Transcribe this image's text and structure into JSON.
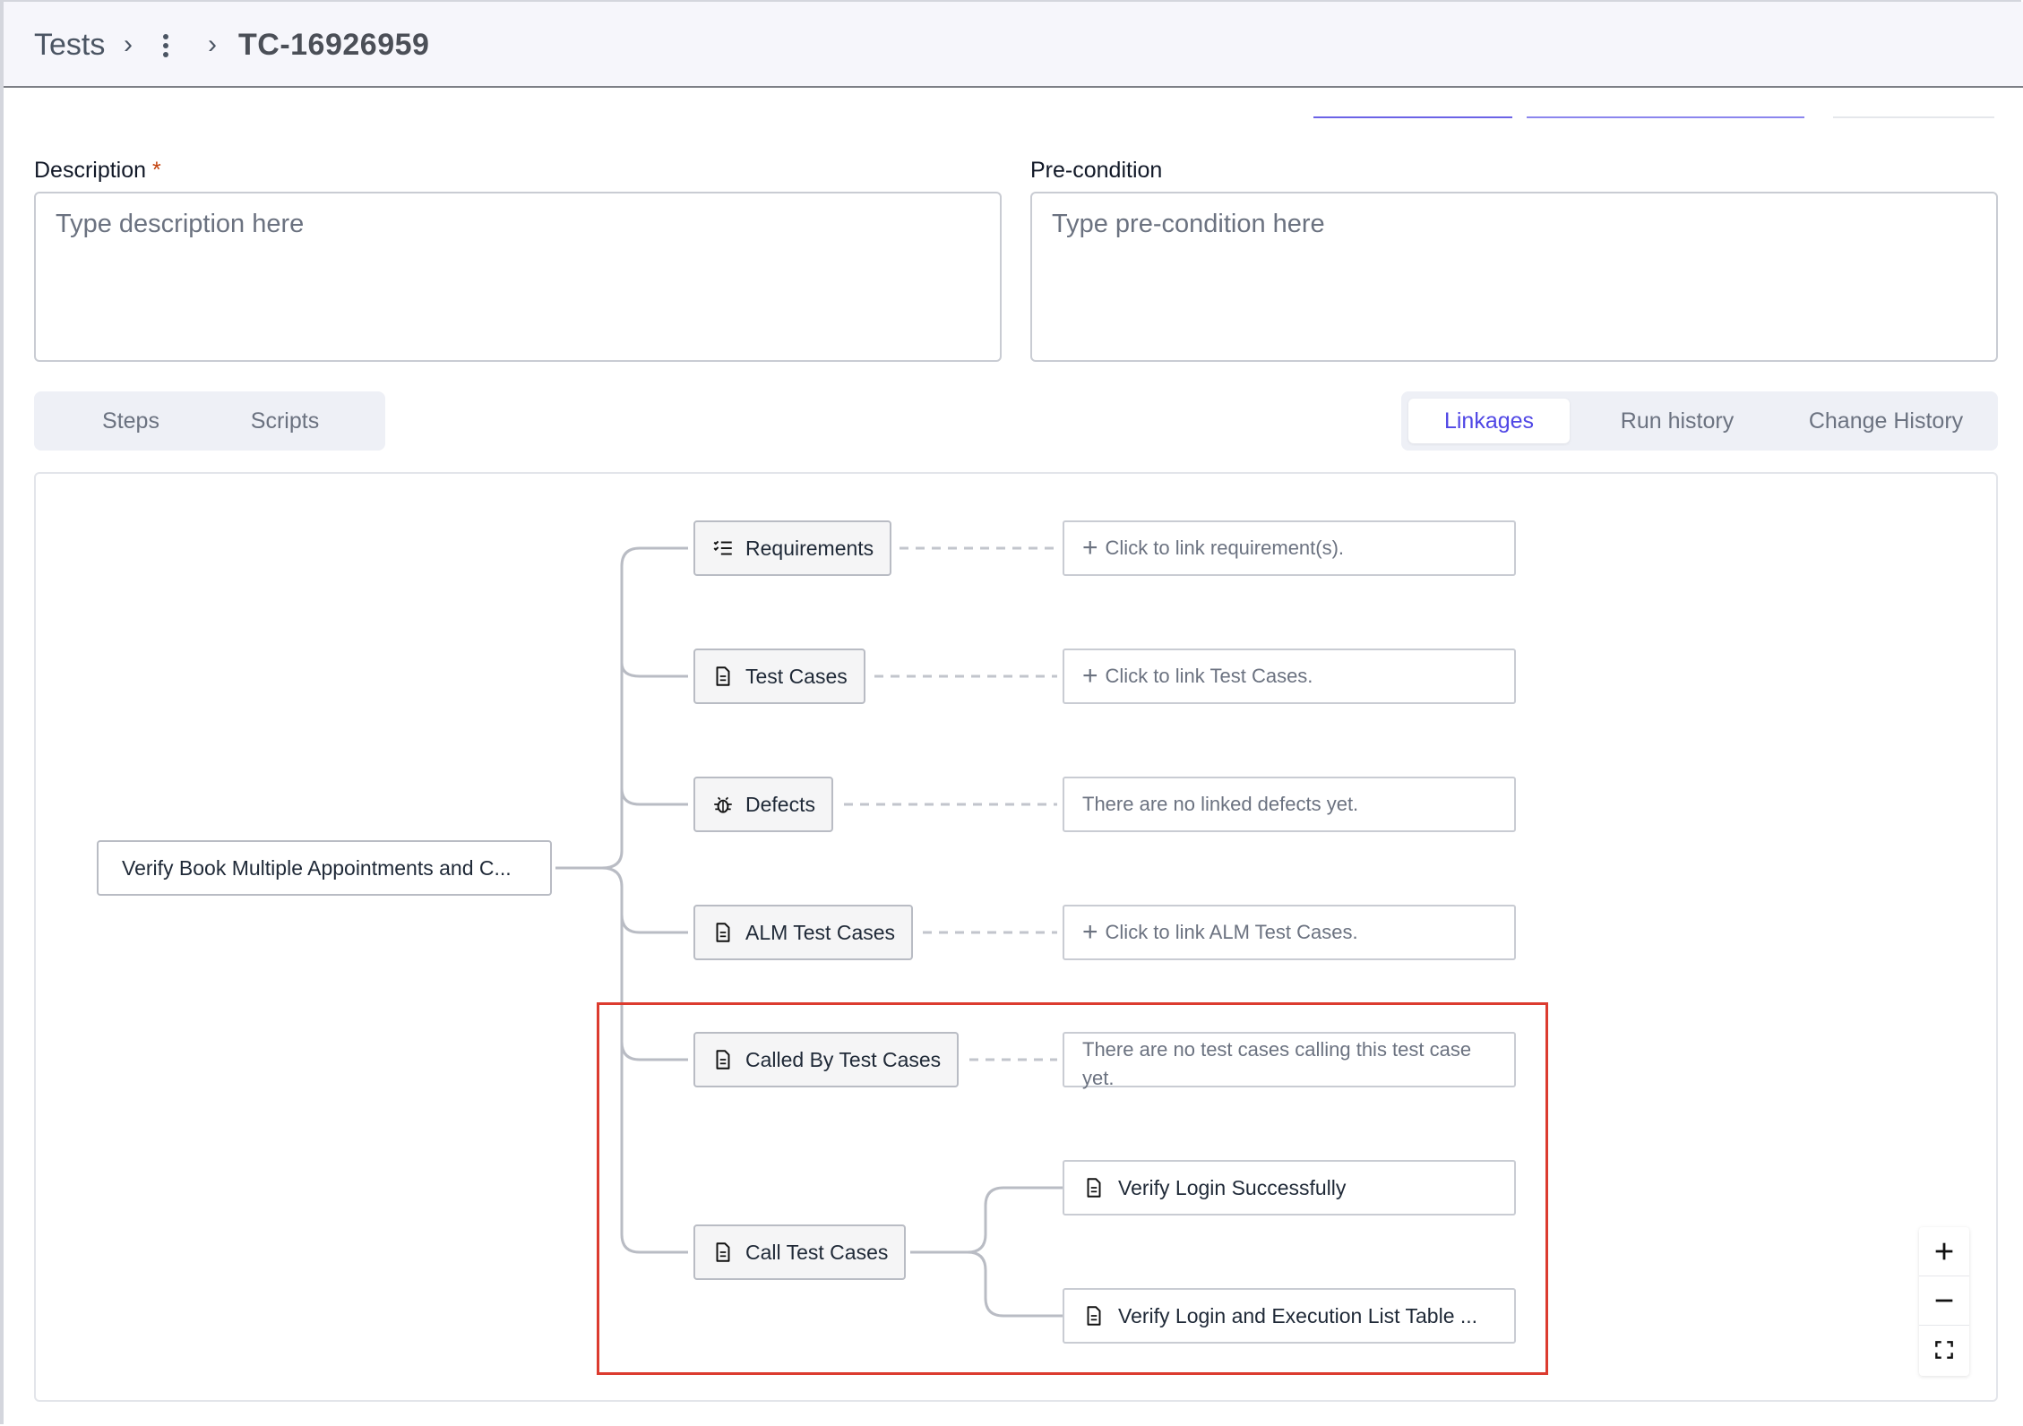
{
  "breadcrumb": {
    "root": "Tests",
    "current": "TC-16926959"
  },
  "form": {
    "description_label": "Description",
    "description_required": "*",
    "description_placeholder": "Type description here",
    "precondition_label": "Pre-condition",
    "precondition_placeholder": "Type pre-condition here"
  },
  "left_tabs": [
    {
      "label": "Steps",
      "active": false
    },
    {
      "label": "Scripts",
      "active": false
    }
  ],
  "right_tabs": [
    {
      "label": "Linkages",
      "active": true
    },
    {
      "label": "Run history",
      "active": false
    },
    {
      "label": "Change History",
      "active": false
    }
  ],
  "linkage_map": {
    "root": "Verify Book Multiple Appointments and C...",
    "branches": [
      {
        "label": "Requirements",
        "icon": "checklist-icon",
        "target": "Click to link requirement(s)."
      },
      {
        "label": "Test Cases",
        "icon": "document-icon",
        "target": "Click to link Test Cases."
      },
      {
        "label": "Defects",
        "icon": "bug-icon",
        "target": "There are no linked defects yet."
      },
      {
        "label": "ALM Test Cases",
        "icon": "document-icon",
        "target": "Click to link ALM Test Cases."
      },
      {
        "label": "Called By Test Cases",
        "icon": "document-icon",
        "target": "There are no test cases calling this test case yet."
      },
      {
        "label": "Call Test Cases",
        "icon": "document-icon",
        "children": [
          "Verify Login Successfully",
          "Verify Login and Execution List Table ..."
        ]
      }
    ]
  },
  "zoom_controls": [
    "zoom-in-icon",
    "zoom-out-icon",
    "fit-screen-icon"
  ],
  "colors": {
    "accent": "#4f46e5",
    "highlight": "#dc3b2f",
    "required": "#c2410c"
  }
}
